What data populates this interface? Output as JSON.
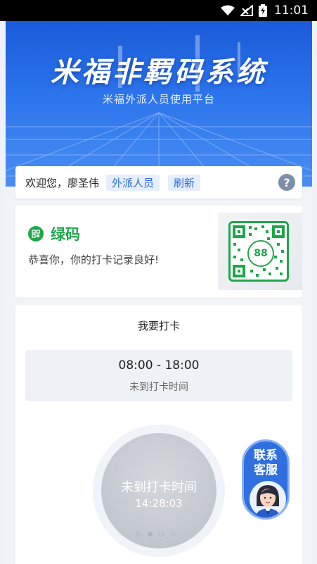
{
  "status_bar": {
    "time": "11:01"
  },
  "banner": {
    "title": "米福非羁码系统",
    "subtitle": "米福外派人员使用平台"
  },
  "welcome": {
    "greeting": "欢迎您，廖圣伟",
    "role_tag": "外派人员",
    "refresh_label": "刷新",
    "help_glyph": "?"
  },
  "code_card": {
    "status": "绿码",
    "message": "恭喜你，你的打卡记录良好!",
    "qr_number": "88",
    "status_color": "#1ea64a"
  },
  "punch": {
    "title": "我要打卡",
    "time_range": "08:00 - 18:00",
    "time_status": "未到打卡时间",
    "button_label": "未到打卡时间",
    "button_time": "14:28:03",
    "page_count": 4,
    "active_page": 2
  },
  "contact": {
    "label_line1": "联系",
    "label_line2": "客服"
  },
  "colors": {
    "accent": "#2f6fe0",
    "banner": "#1a5bd9",
    "green": "#1ea64a"
  }
}
